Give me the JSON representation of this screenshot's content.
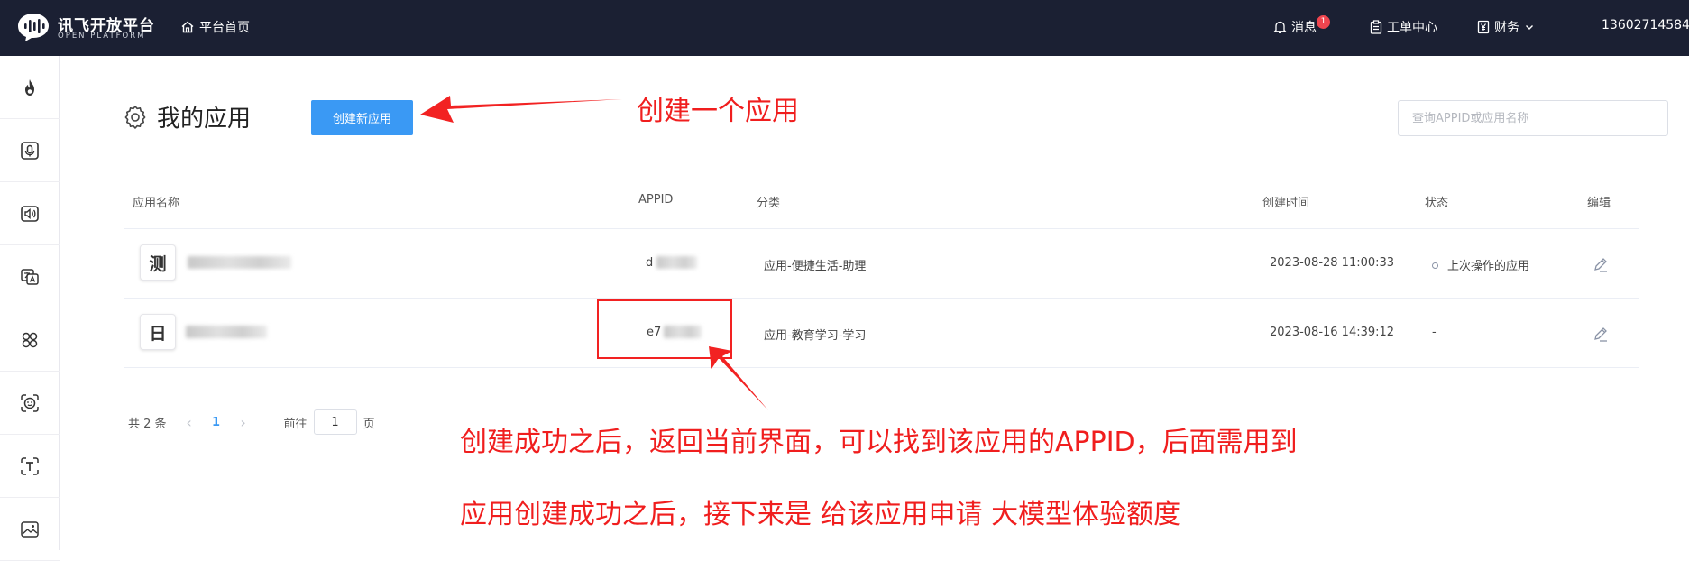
{
  "header": {
    "logo_title": "讯飞开放平台",
    "logo_subtitle": "OPEN PLATFORM",
    "home_label": "平台首页",
    "messages_label": "消息",
    "messages_badge": "1",
    "workorder_label": "工单中心",
    "finance_label": "财务",
    "user_phone": "13602714584"
  },
  "sidebar": {
    "items": [
      {
        "icon": "flame-icon"
      },
      {
        "icon": "speech-recognition-icon"
      },
      {
        "icon": "speech-synthesis-icon"
      },
      {
        "icon": "translation-icon"
      },
      {
        "icon": "apps-icon"
      },
      {
        "icon": "face-recognition-icon"
      },
      {
        "icon": "text-recognition-icon"
      },
      {
        "icon": "image-icon"
      }
    ]
  },
  "main": {
    "title": "我的应用",
    "create_button": "创建新应用",
    "search_placeholder": "查询APPID或应用名称",
    "columns": [
      "应用名称",
      "APPID",
      "分类",
      "创建时间",
      "状态",
      "编辑"
    ],
    "rows": [
      {
        "avatar": "测",
        "appid": "d",
        "category": "应用-便捷生活-助理",
        "created": "2023-08-28 11:00:33",
        "status": "上次操作的应用"
      },
      {
        "avatar": "日",
        "appid": "e7",
        "category": "应用-教育学习-学习",
        "created": "2023-08-16 14:39:12",
        "status": "-"
      }
    ],
    "pagination": {
      "total_label": "共 2 条",
      "current_page": "1",
      "goto_label": "前往",
      "goto_value": "1",
      "page_suffix": "页"
    }
  },
  "annotations": {
    "create_app": "创建一个应用",
    "after_create": "创建成功之后，返回当前界面，可以找到该应用的APPID，后面需用到",
    "next_step": "应用创建成功之后，接下来是 给该应用申请 大模型体验额度"
  },
  "colors": {
    "topbar": "#1b2033",
    "primary": "#3a99f4",
    "annotation": "#f01e1e"
  }
}
